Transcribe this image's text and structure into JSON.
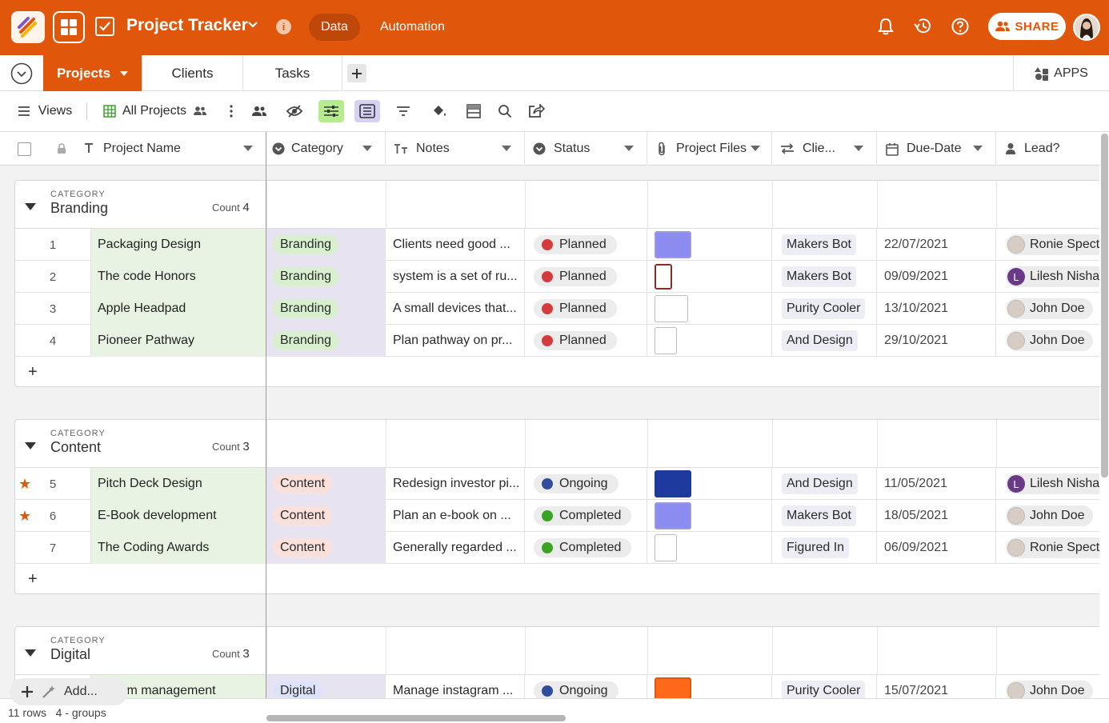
{
  "app": {
    "title": "Project Tracker",
    "nav": [
      "Data",
      "Automation"
    ],
    "share": "SHARE"
  },
  "tabs": [
    {
      "label": "Projects"
    },
    {
      "label": "Clients"
    },
    {
      "label": "Tasks"
    }
  ],
  "apps_label": "APPS",
  "toolbar": {
    "views": "Views",
    "current_view": "All Projects"
  },
  "columns": [
    "Project Name",
    "Category",
    "Notes",
    "Status",
    "Project Files",
    "Clie...",
    "Due-Date",
    "Lead?"
  ],
  "category_caption": "CATEGORY",
  "count_caption": "Count",
  "groups": [
    {
      "name": "Branding",
      "count": "4",
      "rows": [
        {
          "num": "1",
          "starred": false,
          "name": "Packaging Design",
          "category": "Branding",
          "notes": "Clients need good ...",
          "status": "Planned",
          "file": "box",
          "client": "Makers Bot",
          "due": "22/07/2021",
          "lead": "Ronie Spector",
          "lead_initial": ""
        },
        {
          "num": "2",
          "starred": false,
          "name": "The code Honors",
          "category": "Branding",
          "notes": "system is a set of ru...",
          "status": "Planned",
          "file": "book",
          "client": "Makers Bot",
          "due": "09/09/2021",
          "lead": "Lilesh Nishad",
          "lead_initial": "L"
        },
        {
          "num": "3",
          "starred": false,
          "name": "Apple Headpad",
          "category": "Branding",
          "notes": "A small devices that...",
          "status": "Planned",
          "file": "headphones",
          "client": "Purity Cooler",
          "due": "13/10/2021",
          "lead": "John Doe",
          "lead_initial": ""
        },
        {
          "num": "4",
          "starred": false,
          "name": "Pioneer Pathway",
          "category": "Branding",
          "notes": "Plan pathway on pr...",
          "status": "Planned",
          "file": "doc",
          "client": "And Design",
          "due": "29/10/2021",
          "lead": "John Doe",
          "lead_initial": ""
        }
      ]
    },
    {
      "name": "Content",
      "count": "3",
      "rows": [
        {
          "num": "5",
          "starred": true,
          "name": "Pitch Deck Design",
          "category": "Content",
          "notes": "Redesign investor pi...",
          "status": "Ongoing",
          "file": "presentation",
          "client": "And Design",
          "due": "11/05/2021",
          "lead": "Lilesh Nishad",
          "lead_initial": "L"
        },
        {
          "num": "6",
          "starred": true,
          "name": "E-Book development",
          "category": "Content",
          "notes": "Plan an e-book on ...",
          "status": "Completed",
          "file": "ebook",
          "client": "Makers Bot",
          "due": "18/05/2021",
          "lead": "John Doe",
          "lead_initial": ""
        },
        {
          "num": "7",
          "starred": false,
          "name": "The Coding Awards",
          "category": "Content",
          "notes": "Generally regarded ...",
          "status": "Completed",
          "file": "doc",
          "client": "Figured In",
          "due": "06/09/2021",
          "lead": "Ronie Spector",
          "lead_initial": ""
        }
      ]
    },
    {
      "name": "Digital",
      "count": "3",
      "rows": [
        {
          "num": "",
          "starred": false,
          "name": "...gram management",
          "category": "Digital",
          "notes": "Manage instagram ...",
          "status": "Ongoing",
          "file": "instagram",
          "client": "Purity Cooler",
          "due": "15/07/2021",
          "lead": "John Doe",
          "lead_initial": ""
        }
      ]
    }
  ],
  "add_label": "Add...",
  "footer": {
    "rows": "11 rows",
    "groups": "4 - groups"
  },
  "colors": {
    "brand": "#e0560b",
    "planned": "#d63b3b",
    "ongoing": "#2f4f9e",
    "completed": "#3aa323",
    "branding_bg": "#d9f0cf",
    "content_bg": "#fbe0dc",
    "digital_bg": "#dde3fb"
  }
}
